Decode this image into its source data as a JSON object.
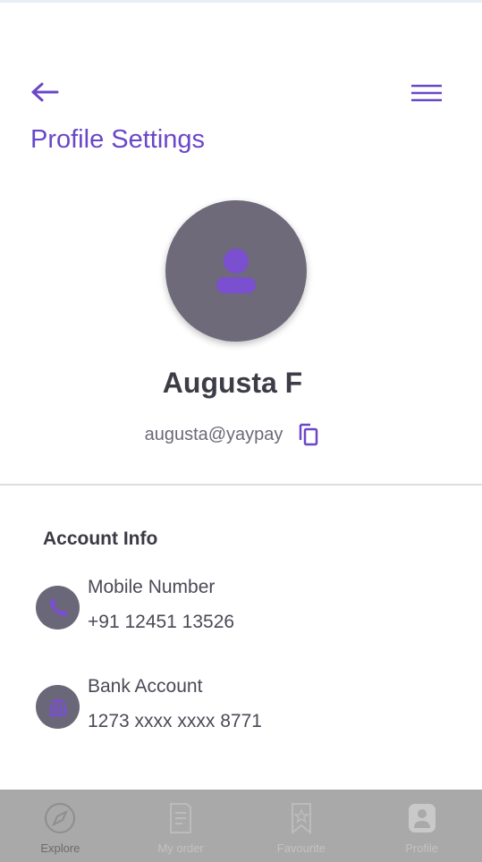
{
  "header": {
    "title": "Profile Settings",
    "back_icon": "arrow-left-icon",
    "menu_icon": "hamburger-menu-icon"
  },
  "profile": {
    "name": "Augusta F",
    "email": "augusta@yaypay",
    "avatar_icon": "user-icon",
    "copy_icon": "copy-icon"
  },
  "account_info": {
    "heading": "Account Info",
    "items": [
      {
        "label": "Mobile Number",
        "value": "+91 12451 13526",
        "icon": "phone-icon"
      },
      {
        "label": "Bank Account",
        "value": "1273 xxxx xxxx 8771",
        "icon": "bank-icon"
      }
    ]
  },
  "bottom_nav": {
    "items": [
      {
        "label": "Explore",
        "icon": "compass-icon",
        "active": true
      },
      {
        "label": "My order",
        "icon": "order-document-icon",
        "active": false
      },
      {
        "label": "Favourite",
        "icon": "bookmark-star-icon",
        "active": false
      },
      {
        "label": "Profile",
        "icon": "profile-icon",
        "active": false
      }
    ]
  },
  "colors": {
    "accent": "#6a47c8",
    "avatar_bg": "#6e6a7a",
    "icon_circle_bg": "#6a6778",
    "nav_bg": "#a9a9a9",
    "text_dark": "#3d3d47"
  }
}
